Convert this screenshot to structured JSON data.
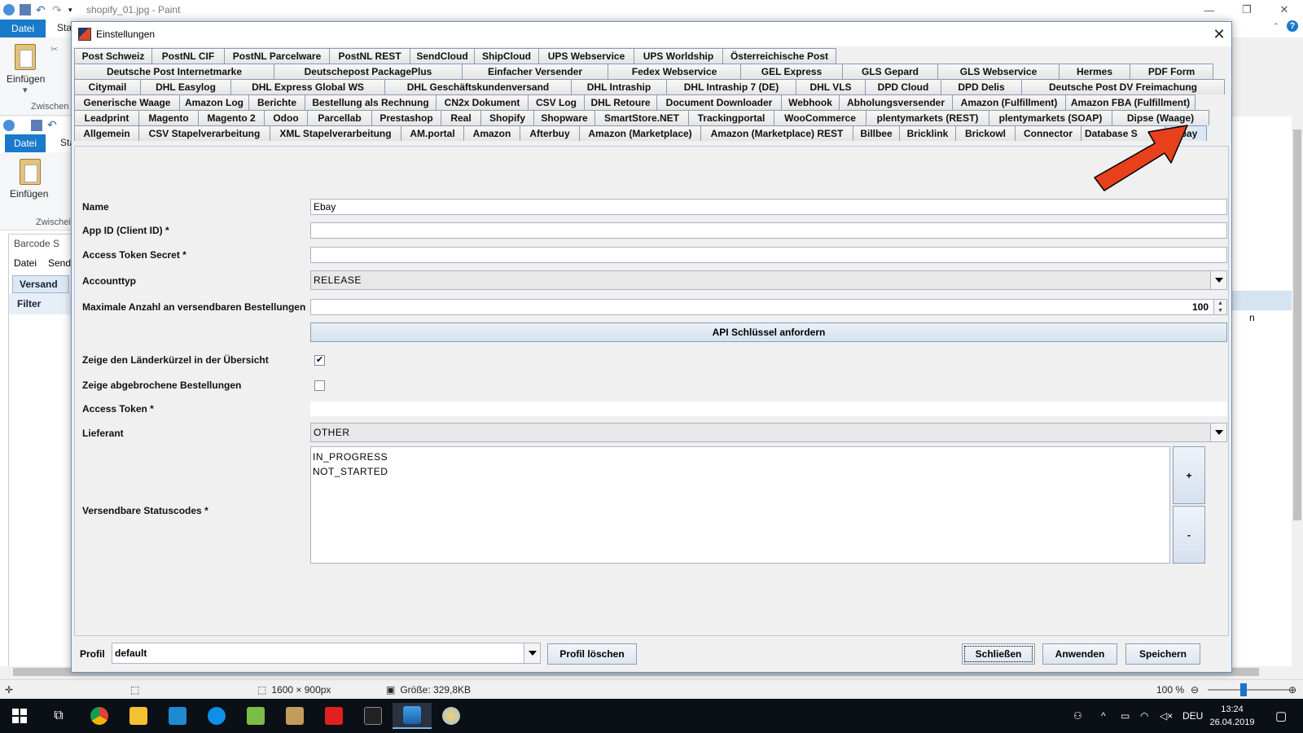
{
  "paint": {
    "title": "shopify_01.jpg - Paint",
    "menu_datei": "Datei",
    "menu_start_partial": "Sta",
    "einfuegen": "Einfügen",
    "zwischen": "Zwischen",
    "inner_datei": "Datei",
    "inner_sta": "Sta",
    "inner_einfuegen": "Einfügen",
    "inner_zwischen": "Zwischei",
    "status_dims": "1600 × 900px",
    "status_size": "Größe: 329,8KB",
    "zoom": "100 %"
  },
  "barcode_window": {
    "title": "Barcode S",
    "menu_datei": "Datei",
    "menu_send": "Send",
    "tab_versand": "Versand",
    "filter": "Filter",
    "right_partial": "n"
  },
  "dialog": {
    "title": "Einstellungen",
    "tab_rows": [
      [
        "Post Schweiz",
        "PostNL CIF",
        "PostNL Parcelware",
        "PostNL REST",
        "SendCloud",
        "ShipCloud",
        "UPS Webservice",
        "UPS Worldship",
        "Österreichische Post"
      ],
      [
        "Deutsche Post Internetmarke",
        "Deutschepost PackagePlus",
        "Einfacher Versender",
        "Fedex Webservice",
        "GEL Express",
        "GLS Gepard",
        "GLS Webservice",
        "Hermes",
        "PDF Form"
      ],
      [
        "Citymail",
        "DHL Easylog",
        "DHL Express Global WS",
        "DHL Geschäftskundenversand",
        "DHL Intraship",
        "DHL Intraship 7 (DE)",
        "DHL VLS",
        "DPD Cloud",
        "DPD Delis",
        "Deutsche Post DV Freimachung"
      ],
      [
        "Generische Waage",
        "Amazon Log",
        "Berichte",
        "Bestellung als Rechnung",
        "CN2x Dokument",
        "CSV Log",
        "DHL Retoure",
        "Document Downloader",
        "Webhook",
        "Abholungsversender",
        "Amazon (Fulfillment)",
        "Amazon FBA (Fulfillment)"
      ],
      [
        "Leadprint",
        "Magento",
        "Magento 2",
        "Odoo",
        "Parcellab",
        "Prestashop",
        "Real",
        "Shopify",
        "Shopware",
        "SmartStore.NET",
        "Trackingportal",
        "WooCommerce",
        "plentymarkets (REST)",
        "plentymarkets (SOAP)",
        "Dipse (Waage)"
      ],
      [
        "Allgemein",
        "CSV Stapelverarbeitung",
        "XML Stapelverarbeitung",
        "AM.portal",
        "Amazon",
        "Afterbuy",
        "Amazon (Marketplace)",
        "Amazon (Marketplace) REST",
        "Billbee",
        "Bricklink",
        "Brickowl",
        "Connector",
        "Database S",
        "Ebay"
      ]
    ],
    "selected_tab": "Ebay",
    "form": {
      "name_label": "Name",
      "name_value": "Ebay",
      "appid_label": "App ID (Client ID) *",
      "appid_value": "",
      "secret_label": "Access Token Secret *",
      "secret_value": "",
      "accounttyp_label": "Accounttyp",
      "accounttyp_value": "RELEASE",
      "max_label": "Maximale Anzahl an versendbaren Bestellungen",
      "max_value": "100",
      "api_button": "API Schlüssel anfordern",
      "laender_label": "Zeige den Länderkürzel in der Übersicht",
      "laender_checked": "✔",
      "abgebrochen_label": "Zeige abgebrochene Bestellungen",
      "abgebrochen_checked": "",
      "token_label": "Access Token *",
      "token_value": "",
      "lieferant_label": "Lieferant",
      "lieferant_value": "OTHER",
      "status_label": "Versendbare Statuscodes *",
      "status_codes": [
        "IN_PROGRESS",
        "NOT_STARTED"
      ],
      "plus": "+",
      "minus": "-"
    },
    "bottom": {
      "profil_label": "Profil",
      "profil_value": "default",
      "profil_loeschen": "Profil löschen",
      "schliessen": "Schließen",
      "anwenden": "Anwenden",
      "speichern": "Speichern"
    }
  },
  "taskbar": {
    "lang": "DEU",
    "time": "13:24",
    "date": "26.04.2019"
  },
  "colors": {
    "accent_blue": "#1979ca",
    "arrow_red": "#e8401c",
    "selected_tab": "#dce7f4"
  }
}
